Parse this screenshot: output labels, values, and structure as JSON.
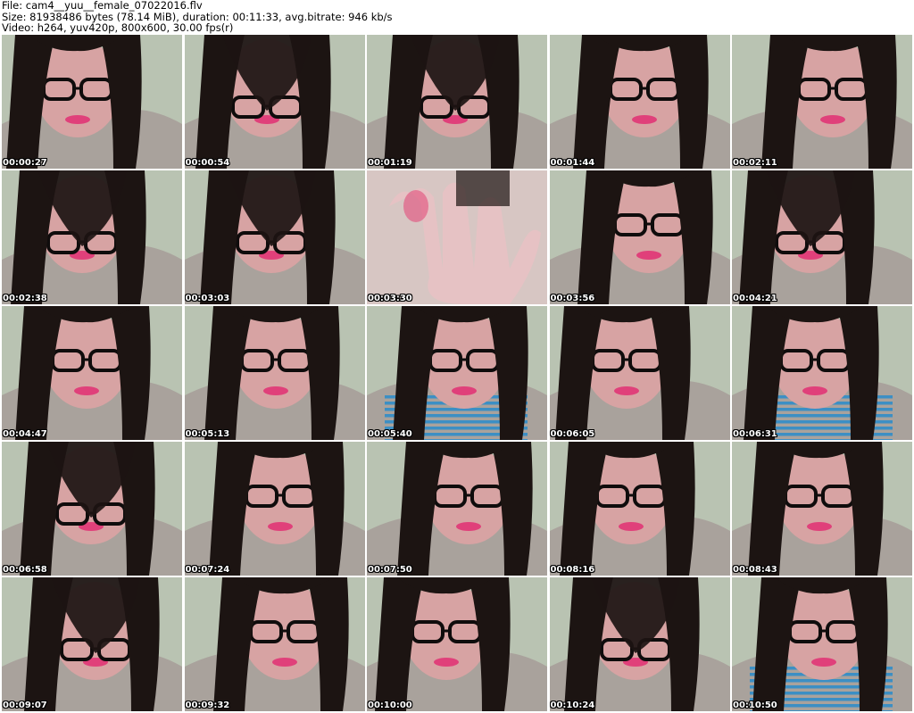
{
  "header": {
    "file_line": "File: cam4__yuu__female_07022016.flv",
    "size_line": "Size: 81938486 bytes (78.14 MiB), duration: 00:11:33, avg.bitrate: 946 kb/s",
    "video_line": "Video: h264, yuv420p, 800x600, 30.00 fps(r)"
  },
  "thumbnails": [
    {
      "time": "00:00:27",
      "kind": "glasses-face"
    },
    {
      "time": "00:00:54",
      "kind": "hair-glasses"
    },
    {
      "time": "00:01:19",
      "kind": "hair-glasses"
    },
    {
      "time": "00:01:44",
      "kind": "glasses-face"
    },
    {
      "time": "00:02:11",
      "kind": "glasses-face"
    },
    {
      "time": "00:02:38",
      "kind": "hair-glasses"
    },
    {
      "time": "00:03:03",
      "kind": "hair-glasses"
    },
    {
      "time": "00:03:30",
      "kind": "hand"
    },
    {
      "time": "00:03:56",
      "kind": "glasses-face"
    },
    {
      "time": "00:04:21",
      "kind": "hair-glasses"
    },
    {
      "time": "00:04:47",
      "kind": "glasses-face"
    },
    {
      "time": "00:05:13",
      "kind": "glasses-face"
    },
    {
      "time": "00:05:40",
      "kind": "striped-top"
    },
    {
      "time": "00:06:05",
      "kind": "glasses-face"
    },
    {
      "time": "00:06:31",
      "kind": "striped-top"
    },
    {
      "time": "00:06:58",
      "kind": "hair-glasses"
    },
    {
      "time": "00:07:24",
      "kind": "glasses-face"
    },
    {
      "time": "00:07:50",
      "kind": "glasses-face"
    },
    {
      "time": "00:08:16",
      "kind": "glasses-face"
    },
    {
      "time": "00:08:43",
      "kind": "glasses-face"
    },
    {
      "time": "00:09:07",
      "kind": "hair-glasses"
    },
    {
      "time": "00:09:32",
      "kind": "glasses-face"
    },
    {
      "time": "00:10:00",
      "kind": "glasses-face"
    },
    {
      "time": "00:10:24",
      "kind": "hair-glasses"
    },
    {
      "time": "00:10:50",
      "kind": "striped-top"
    }
  ],
  "colors": {
    "wall": "#c9d3c3",
    "hair": "#1c1412",
    "skin": "#d7a3a3",
    "lips": "#e0407a",
    "cardigan": "#a9a29c",
    "stripe_blue": "#3c8fc4",
    "glasses": "#0f0c0c"
  }
}
